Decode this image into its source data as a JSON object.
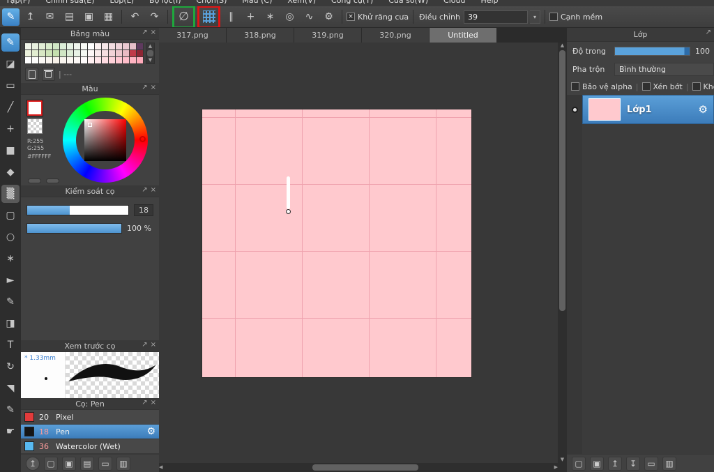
{
  "colors": {
    "accent_blue": "#4f97d7",
    "slider_blue": "#5aa2dc",
    "canvas_pink": "#ffc9ce",
    "canvas_grid": "#efa2ae",
    "highlight_green": "#1ea83c",
    "highlight_red": "#e31414",
    "selected_blue_top": "#5b9fd8",
    "selected_blue_bottom": "#3c7cba"
  },
  "icons": {
    "popup": "↗",
    "close": "×",
    "up": "▲",
    "down": "▼",
    "left": "◀",
    "right": "▶",
    "dropdown": "▾",
    "gear": "⚙",
    "check": "×"
  },
  "menubar": {
    "items": [
      "Tập(F)",
      "Chỉnh sửa(E)",
      "Lớp(L)",
      "Bộ lọc(I)",
      "Chọn(S)",
      "Màu (C)",
      "Xem(V)",
      "Công cụ(T)",
      "Cửa sổ(W)",
      "Cloud",
      "Help"
    ]
  },
  "toolbar": {
    "file_icons": [
      {
        "name": "brand-brush-icon",
        "glyph": "✎",
        "cls": "brand"
      },
      {
        "name": "publish-icon",
        "glyph": "↥"
      },
      {
        "name": "comment-icon",
        "glyph": "✉"
      },
      {
        "name": "save-icon",
        "glyph": "▤"
      },
      {
        "name": "new-canvas-icon",
        "glyph": "▣"
      },
      {
        "name": "comic-panel-icon",
        "glyph": "▦"
      }
    ],
    "history_icons": [
      {
        "name": "undo-icon",
        "glyph": "↶"
      },
      {
        "name": "redo-icon",
        "glyph": "↷"
      }
    ],
    "nosnap_glyph": "∅",
    "snap_icons": [
      {
        "name": "parallel-snap-icon",
        "glyph": "∥"
      },
      {
        "name": "cross-snap-icon",
        "glyph": "+"
      },
      {
        "name": "vanishing-point-snap-icon",
        "glyph": "∗"
      },
      {
        "name": "concentric-snap-icon",
        "glyph": "◎"
      },
      {
        "name": "curve-snap-icon",
        "glyph": "∿"
      },
      {
        "name": "snap-settings-icon",
        "glyph": "⚙"
      }
    ],
    "antialias_label": "Khử răng cưa",
    "adjust_label": "Điều chỉnh",
    "adjust_value": "39",
    "soft_edge_label": "Cạnh mềm"
  },
  "tabs": [
    {
      "label": "317.png"
    },
    {
      "label": "318.png"
    },
    {
      "label": "319.png"
    },
    {
      "label": "320.png"
    },
    {
      "label": "Untitled",
      "active": true
    }
  ],
  "toolstrip": {
    "tools": [
      {
        "name": "brush-tool",
        "glyph": "✎",
        "active": true
      },
      {
        "name": "eraser-tool",
        "glyph": "◪"
      },
      {
        "name": "marquee-rect-tool",
        "glyph": "▭"
      },
      {
        "name": "line-tool",
        "glyph": "╱"
      },
      {
        "name": "move-tool",
        "glyph": "+"
      },
      {
        "name": "fill-shape-tool",
        "glyph": "■"
      },
      {
        "name": "bucket-tool",
        "glyph": "◆"
      },
      {
        "name": "gradient-tool",
        "glyph": "▒",
        "cls": "active-gray"
      },
      {
        "name": "select-rect-tool",
        "glyph": "▢"
      },
      {
        "name": "lasso-tool",
        "glyph": "○"
      },
      {
        "name": "magic-wand-tool",
        "glyph": "∗"
      },
      {
        "name": "operation-tool",
        "glyph": "►"
      },
      {
        "name": "select-pen-tool",
        "glyph": "✎"
      },
      {
        "name": "select-eraser-tool",
        "glyph": "◨"
      },
      {
        "name": "text-tool",
        "glyph": "T"
      },
      {
        "name": "rotate-tool",
        "glyph": "↻"
      },
      {
        "name": "eyedropper-tool",
        "glyph": "◥"
      },
      {
        "name": "pencil-tool",
        "glyph": "✎"
      },
      {
        "name": "hand-tool",
        "glyph": "☛"
      }
    ]
  },
  "palette_panel": {
    "title": "Bảng màu",
    "divider_text": "| ---",
    "swatches": [
      "#f2f6ea",
      "#eaf2e0",
      "#e2eed6",
      "#daeccc",
      "#d2e8c6",
      "#dceed8",
      "#e6f2e4",
      "#f0f6ee",
      "#fafcf8",
      "#ffffff",
      "#fbf1f1",
      "#f7e7e9",
      "#f3dde1",
      "#efd3d9",
      "#ebc9d1",
      "#e7bfc9",
      "#5e3a5e",
      "#ecf2dc",
      "#e2eed0",
      "#d8e8c4",
      "#cee4b8",
      "#c4e0ae",
      "#d0e6c4",
      "#dcecd6",
      "#e8f2e6",
      "#f4f8f2",
      "#fdf7f7",
      "#f9ebeb",
      "#f5dfe1",
      "#f1d3d7",
      "#edc7cd",
      "#e9bbc3",
      "#c03a48",
      "#8e2533",
      "#ffffff",
      "#fdfdfb",
      "#fbf9f5",
      "#f9f5ef",
      "#f7f1e9",
      "#f8f4ee",
      "#faf6f2",
      "#fcf8f6",
      "#fefbfa",
      "#fff0f2",
      "#ffe6ea",
      "#ffdce2",
      "#ffd2da",
      "#ffc8d2",
      "#ffbeca",
      "#ffb4c2",
      "#ffaaba"
    ]
  },
  "color_panel": {
    "title": "Màu",
    "r_label": "R:255",
    "g_label": "G:255",
    "hex_label": "#FFFFFF"
  },
  "brush_control_panel": {
    "title": "Kiểm soát cọ",
    "size_value": "18",
    "size_pct": 42,
    "opacity_value": "100 %",
    "opacity_pct": 100
  },
  "brush_preview_panel": {
    "title": "Xem trước cọ",
    "star": "*",
    "size_label": "1.33mm"
  },
  "brush_list_panel": {
    "title": "Cọ: Pen",
    "brushes": [
      {
        "size": "20",
        "name": "Pixel",
        "swatch": "#e23b3b",
        "size_color": "#f0f0f0"
      },
      {
        "size": "18",
        "name": "Pen",
        "swatch": "#151515",
        "size_color": "#ff9d9d",
        "selected": true
      },
      {
        "size": "36",
        "name": "Watercolor (Wet)",
        "swatch": "#58b9f0",
        "size_color": "#ff9d9d"
      }
    ]
  },
  "left_footer": {
    "icons": [
      {
        "name": "upload-cloud-button",
        "glyph": "↥",
        "cls": "round"
      },
      {
        "name": "new-item-button",
        "glyph": "▢"
      },
      {
        "name": "duplicate-item-button",
        "glyph": "▣"
      },
      {
        "name": "item-list-button",
        "glyph": "▤"
      },
      {
        "name": "folder-button",
        "glyph": "▭"
      },
      {
        "name": "copy-button",
        "glyph": "▥"
      }
    ]
  },
  "layer_panel": {
    "title": "Lớp",
    "opacity_label": "Độ trong",
    "opacity_value": "100",
    "opacity_pct": 100,
    "blend_label": "Pha trộn",
    "blend_value": "Bình thường",
    "checkbox_protect": "Bảo vệ alpha",
    "checkbox_clip": "Xén bớt",
    "checkbox_lock": "Khó",
    "layers": [
      {
        "name": "Lớp1",
        "thumb": "#ffc9ce",
        "selected": true
      }
    ]
  },
  "right_footer": {
    "icons": [
      {
        "name": "new-layer-button",
        "glyph": "▢"
      },
      {
        "name": "layer-property-button",
        "glyph": "▣"
      },
      {
        "name": "merge-up-button",
        "glyph": "↥"
      },
      {
        "name": "merge-down-button",
        "glyph": "↧"
      },
      {
        "name": "new-folder-button",
        "glyph": "▭"
      },
      {
        "name": "duplicate-layer-button",
        "glyph": "▥"
      }
    ]
  }
}
